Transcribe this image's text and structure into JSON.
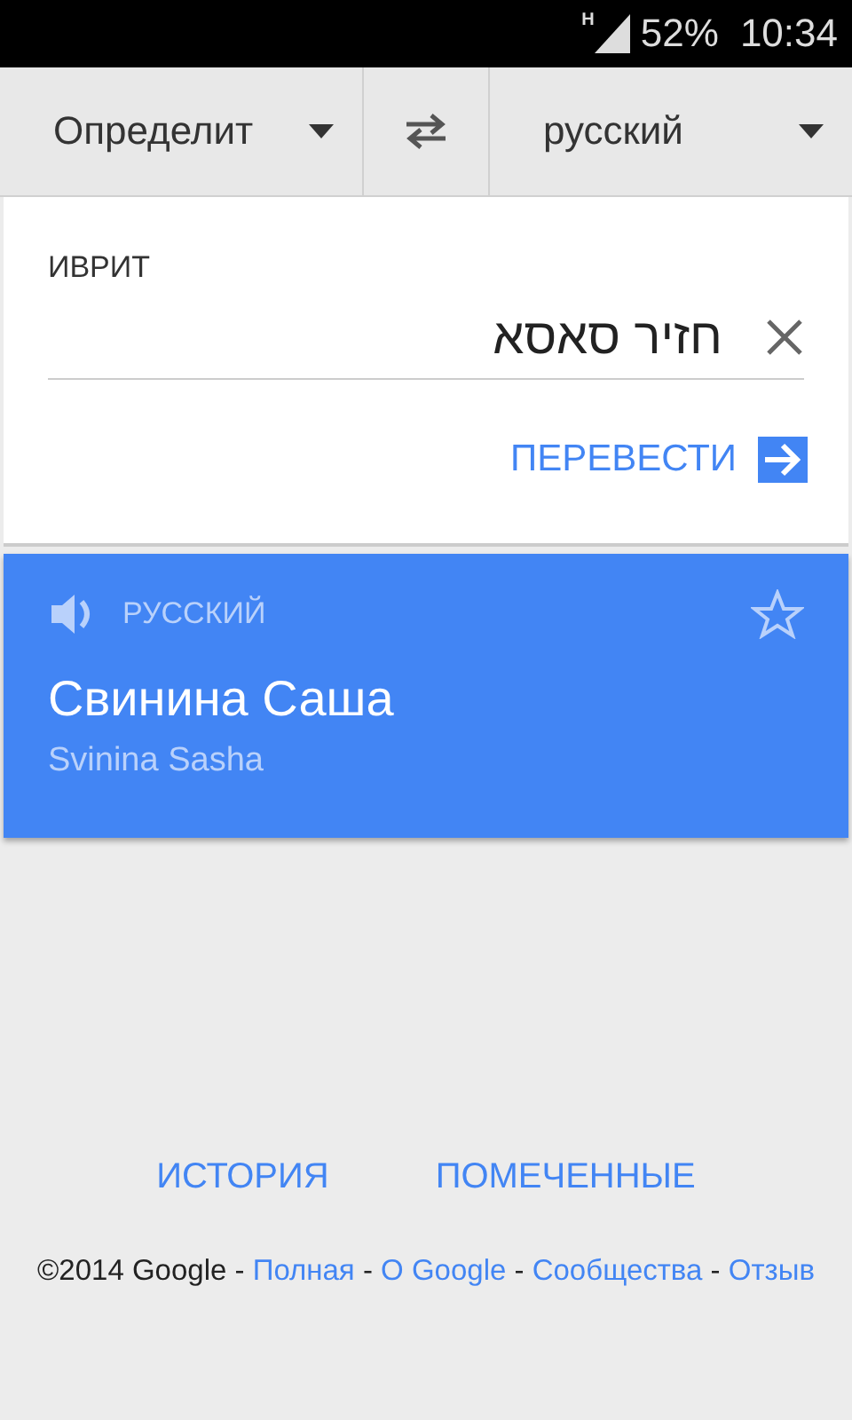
{
  "status_bar": {
    "network": "H",
    "battery": "52%",
    "time": "10:34"
  },
  "language_bar": {
    "source": "Определит",
    "target": "русский"
  },
  "input_card": {
    "language": "ИВРИТ",
    "value": "חזיר סאסא",
    "translate_button": "ПЕРЕВЕСТИ"
  },
  "result_card": {
    "language": "РУССКИЙ",
    "translation": "Свинина Саша",
    "transliteration": "Svinina Sasha",
    "starred": false
  },
  "bottom_links": [
    {
      "label": "ИСТОРИЯ"
    },
    {
      "label": "ПОМЕЧЕННЫЕ"
    }
  ],
  "footer": {
    "copyright": "©2014 Google",
    "links": [
      {
        "label": "Полная",
        "separator": "-"
      },
      {
        "label": "О Google",
        "separator": "-"
      },
      {
        "label": "Сообщества",
        "separator": "-"
      },
      {
        "label": "Отзыв",
        "separator": "-"
      }
    ]
  }
}
